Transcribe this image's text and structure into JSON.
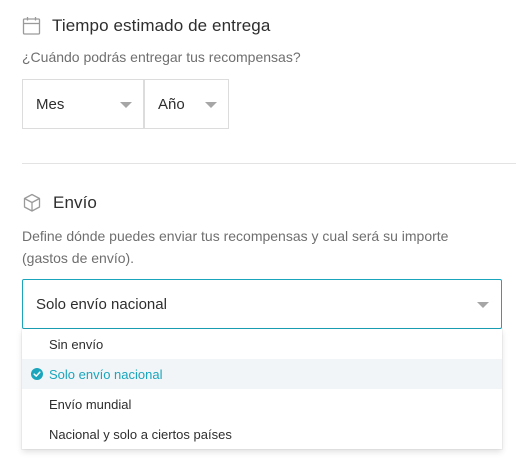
{
  "delivery": {
    "title": "Tiempo estimado de entrega",
    "help": "¿Cuándo podrás entregar tus recompensas?",
    "month": {
      "value": "Mes"
    },
    "year": {
      "value": "Año"
    }
  },
  "shipping": {
    "title": "Envío",
    "help_line1": "Define dónde puedes enviar tus recompensas y cual será su importe",
    "help_line2": "(gastos de envío).",
    "selected": "Solo envío nacional",
    "options": [
      {
        "label": "Sin envío",
        "selected": false
      },
      {
        "label": "Solo envío nacional",
        "selected": true
      },
      {
        "label": "Envío mundial",
        "selected": false
      },
      {
        "label": "Nacional y solo a ciertos países",
        "selected": false
      }
    ]
  },
  "icons": {
    "calendar": "calendar-icon",
    "box": "box-icon",
    "caret": "caret-down-icon",
    "check": "check-circle-icon"
  },
  "colors": {
    "accent": "#1aa5bd",
    "text": "#2e2e2e",
    "muted": "#6f6f6f",
    "border": "#dcdcdc",
    "selected_bg": "#f1f5f7"
  }
}
